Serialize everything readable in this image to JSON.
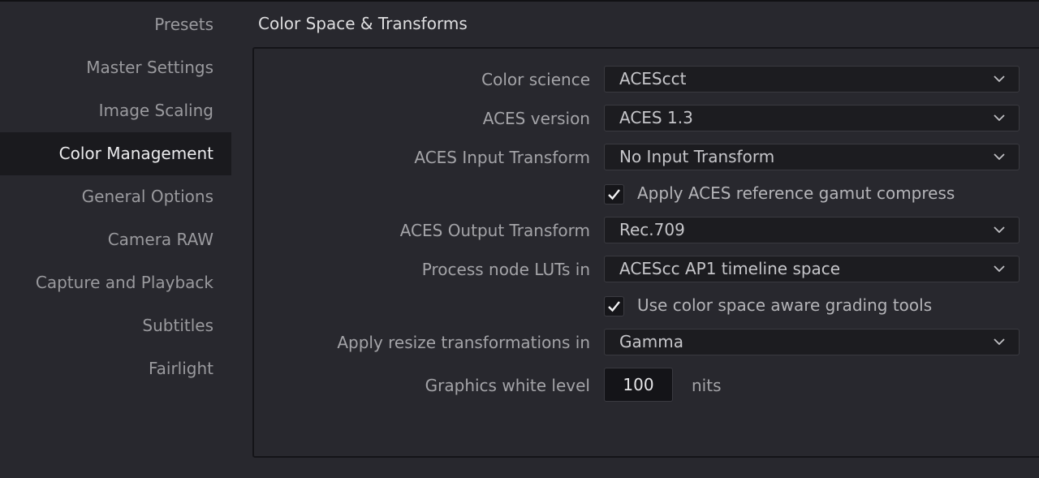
{
  "sidebar": {
    "items": [
      {
        "label": "Presets"
      },
      {
        "label": "Master Settings"
      },
      {
        "label": "Image Scaling"
      },
      {
        "label": "Color Management"
      },
      {
        "label": "General Options"
      },
      {
        "label": "Camera RAW"
      },
      {
        "label": "Capture and Playback"
      },
      {
        "label": "Subtitles"
      },
      {
        "label": "Fairlight"
      }
    ],
    "active": "Color Management"
  },
  "section": {
    "title": "Color Space & Transforms"
  },
  "form": {
    "color_science": {
      "label": "Color science",
      "value": "ACEScct"
    },
    "aces_version": {
      "label": "ACES version",
      "value": "ACES 1.3"
    },
    "aces_input_transform": {
      "label": "ACES Input Transform",
      "value": "No Input Transform"
    },
    "gamut_compress": {
      "label": "Apply ACES reference gamut compress",
      "checked": true
    },
    "aces_output_transform": {
      "label": "ACES Output Transform",
      "value": "Rec.709"
    },
    "process_node_luts": {
      "label": "Process node LUTs in",
      "value": "ACEScc AP1 timeline space"
    },
    "color_space_aware": {
      "label": "Use color space aware grading tools",
      "checked": true
    },
    "resize_transformations": {
      "label": "Apply resize transformations in",
      "value": "Gamma"
    },
    "graphics_white_level": {
      "label": "Graphics white level",
      "value": "100",
      "unit": "nits"
    }
  },
  "icons": {
    "dropdown": "chevron-down-icon",
    "checkbox": "checkmark-icon"
  },
  "colors": {
    "background": "#28282e",
    "sidebar_active_bg": "#1a1a1e",
    "field_bg": "#1c1c20",
    "text_active": "#ececee",
    "text_muted": "#9a9a9e"
  }
}
